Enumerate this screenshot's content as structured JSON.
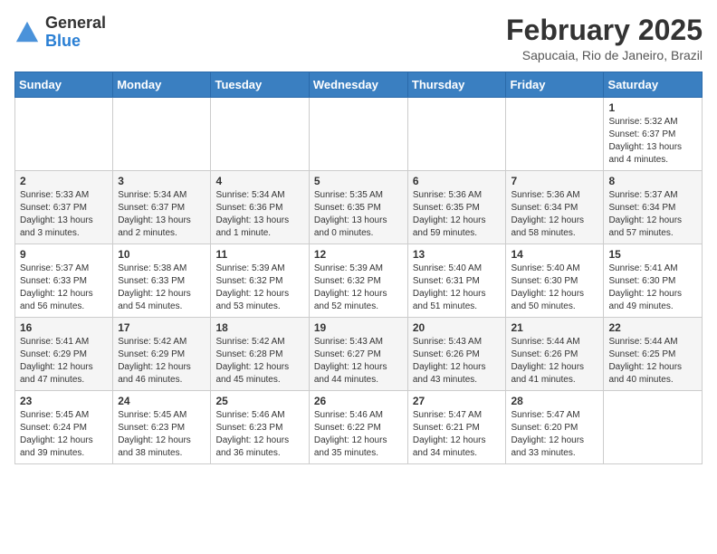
{
  "header": {
    "logo_general": "General",
    "logo_blue": "Blue",
    "month_year": "February 2025",
    "location": "Sapucaia, Rio de Janeiro, Brazil"
  },
  "days_of_week": [
    "Sunday",
    "Monday",
    "Tuesday",
    "Wednesday",
    "Thursday",
    "Friday",
    "Saturday"
  ],
  "weeks": [
    [
      {
        "day": "",
        "info": ""
      },
      {
        "day": "",
        "info": ""
      },
      {
        "day": "",
        "info": ""
      },
      {
        "day": "",
        "info": ""
      },
      {
        "day": "",
        "info": ""
      },
      {
        "day": "",
        "info": ""
      },
      {
        "day": "1",
        "info": "Sunrise: 5:32 AM\nSunset: 6:37 PM\nDaylight: 13 hours\nand 4 minutes."
      }
    ],
    [
      {
        "day": "2",
        "info": "Sunrise: 5:33 AM\nSunset: 6:37 PM\nDaylight: 13 hours\nand 3 minutes."
      },
      {
        "day": "3",
        "info": "Sunrise: 5:34 AM\nSunset: 6:37 PM\nDaylight: 13 hours\nand 2 minutes."
      },
      {
        "day": "4",
        "info": "Sunrise: 5:34 AM\nSunset: 6:36 PM\nDaylight: 13 hours\nand 1 minute."
      },
      {
        "day": "5",
        "info": "Sunrise: 5:35 AM\nSunset: 6:35 PM\nDaylight: 13 hours\nand 0 minutes."
      },
      {
        "day": "6",
        "info": "Sunrise: 5:36 AM\nSunset: 6:35 PM\nDaylight: 12 hours\nand 59 minutes."
      },
      {
        "day": "7",
        "info": "Sunrise: 5:36 AM\nSunset: 6:34 PM\nDaylight: 12 hours\nand 58 minutes."
      },
      {
        "day": "8",
        "info": "Sunrise: 5:37 AM\nSunset: 6:34 PM\nDaylight: 12 hours\nand 57 minutes."
      }
    ],
    [
      {
        "day": "9",
        "info": "Sunrise: 5:37 AM\nSunset: 6:33 PM\nDaylight: 12 hours\nand 56 minutes."
      },
      {
        "day": "10",
        "info": "Sunrise: 5:38 AM\nSunset: 6:33 PM\nDaylight: 12 hours\nand 54 minutes."
      },
      {
        "day": "11",
        "info": "Sunrise: 5:39 AM\nSunset: 6:32 PM\nDaylight: 12 hours\nand 53 minutes."
      },
      {
        "day": "12",
        "info": "Sunrise: 5:39 AM\nSunset: 6:32 PM\nDaylight: 12 hours\nand 52 minutes."
      },
      {
        "day": "13",
        "info": "Sunrise: 5:40 AM\nSunset: 6:31 PM\nDaylight: 12 hours\nand 51 minutes."
      },
      {
        "day": "14",
        "info": "Sunrise: 5:40 AM\nSunset: 6:30 PM\nDaylight: 12 hours\nand 50 minutes."
      },
      {
        "day": "15",
        "info": "Sunrise: 5:41 AM\nSunset: 6:30 PM\nDaylight: 12 hours\nand 49 minutes."
      }
    ],
    [
      {
        "day": "16",
        "info": "Sunrise: 5:41 AM\nSunset: 6:29 PM\nDaylight: 12 hours\nand 47 minutes."
      },
      {
        "day": "17",
        "info": "Sunrise: 5:42 AM\nSunset: 6:29 PM\nDaylight: 12 hours\nand 46 minutes."
      },
      {
        "day": "18",
        "info": "Sunrise: 5:42 AM\nSunset: 6:28 PM\nDaylight: 12 hours\nand 45 minutes."
      },
      {
        "day": "19",
        "info": "Sunrise: 5:43 AM\nSunset: 6:27 PM\nDaylight: 12 hours\nand 44 minutes."
      },
      {
        "day": "20",
        "info": "Sunrise: 5:43 AM\nSunset: 6:26 PM\nDaylight: 12 hours\nand 43 minutes."
      },
      {
        "day": "21",
        "info": "Sunrise: 5:44 AM\nSunset: 6:26 PM\nDaylight: 12 hours\nand 41 minutes."
      },
      {
        "day": "22",
        "info": "Sunrise: 5:44 AM\nSunset: 6:25 PM\nDaylight: 12 hours\nand 40 minutes."
      }
    ],
    [
      {
        "day": "23",
        "info": "Sunrise: 5:45 AM\nSunset: 6:24 PM\nDaylight: 12 hours\nand 39 minutes."
      },
      {
        "day": "24",
        "info": "Sunrise: 5:45 AM\nSunset: 6:23 PM\nDaylight: 12 hours\nand 38 minutes."
      },
      {
        "day": "25",
        "info": "Sunrise: 5:46 AM\nSunset: 6:23 PM\nDaylight: 12 hours\nand 36 minutes."
      },
      {
        "day": "26",
        "info": "Sunrise: 5:46 AM\nSunset: 6:22 PM\nDaylight: 12 hours\nand 35 minutes."
      },
      {
        "day": "27",
        "info": "Sunrise: 5:47 AM\nSunset: 6:21 PM\nDaylight: 12 hours\nand 34 minutes."
      },
      {
        "day": "28",
        "info": "Sunrise: 5:47 AM\nSunset: 6:20 PM\nDaylight: 12 hours\nand 33 minutes."
      },
      {
        "day": "",
        "info": ""
      }
    ]
  ]
}
